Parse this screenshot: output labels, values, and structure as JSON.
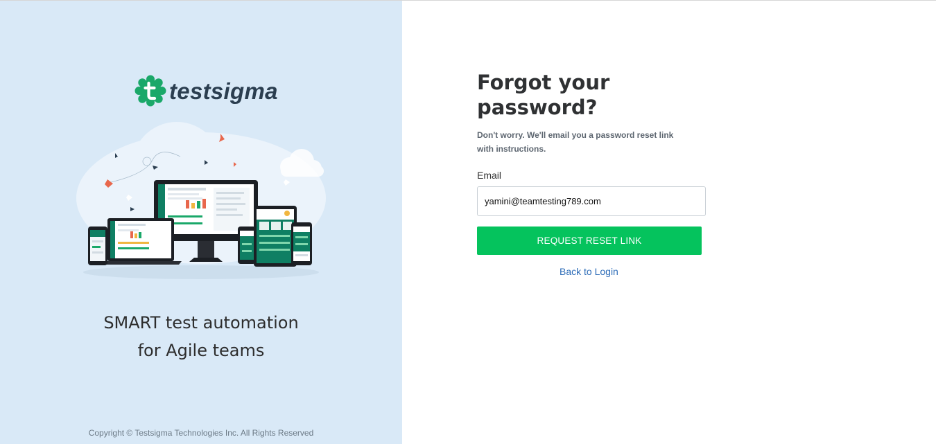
{
  "brand": {
    "name": "testsigma",
    "accent_color": "#05c35d",
    "logo_icon": "testsigma-gear-logo-icon"
  },
  "left_panel": {
    "background_color": "#d9e9f7",
    "illustration": "devices-illustration",
    "tagline": "SMART test automation for Agile teams",
    "copyright": "Copyright © Testsigma Technologies Inc. All Rights Reserved"
  },
  "form": {
    "title": "Forgot your password?",
    "subtitle": "Don't worry. We'll email you a password reset link with instructions.",
    "email_label": "Email",
    "email_value": "yamini@teamtesting789.com",
    "submit_label": "REQUEST RESET LINK",
    "back_link": "Back to Login"
  }
}
